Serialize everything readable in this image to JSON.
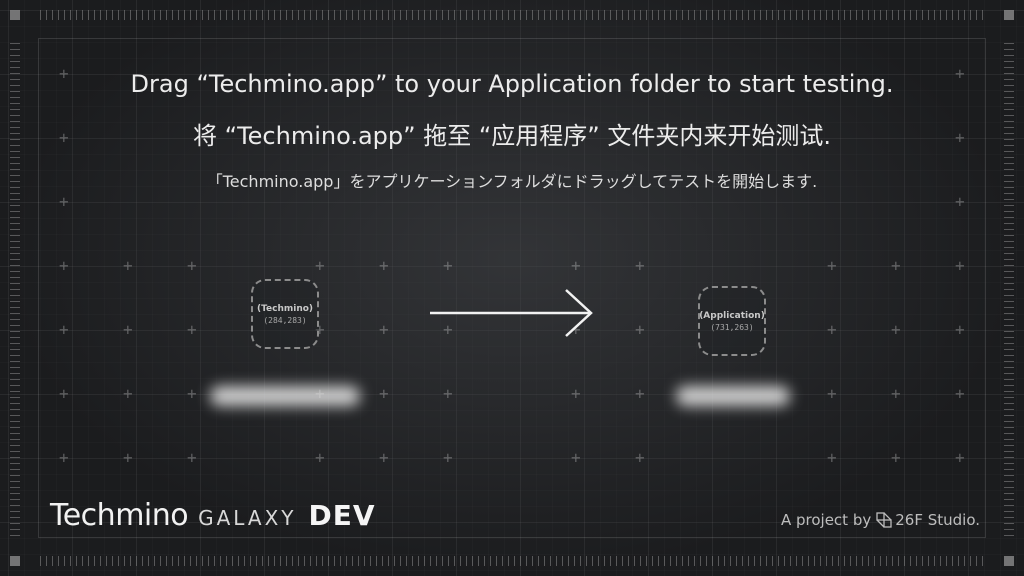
{
  "instructions": {
    "english": "Drag “Techmino.app” to your Application folder to start testing.",
    "chinese": "将 “Techmino.app” 拖至 “应用程序” 文件夹内来开始测试.",
    "japanese": "「Techmino.app」をアプリケーションフォルダにドラッグしてテストを開始します."
  },
  "source_item": {
    "label": "(Techmino)",
    "coords": "(284,283)"
  },
  "target_item": {
    "label": "(Application)",
    "coords": "(731,263)"
  },
  "branding": {
    "name": "Techmino",
    "edition": "GALAXY",
    "channel": "DEV"
  },
  "credit": {
    "prefix": "A project by",
    "studio": "26F Studio."
  },
  "icons": {
    "drag_arrow": "arrow-right-icon",
    "studio_logo": "26f-studio-icon"
  },
  "colors": {
    "background": "#1b1c1e",
    "text": "#ececec",
    "dashed_border": "#8c8c8c"
  }
}
